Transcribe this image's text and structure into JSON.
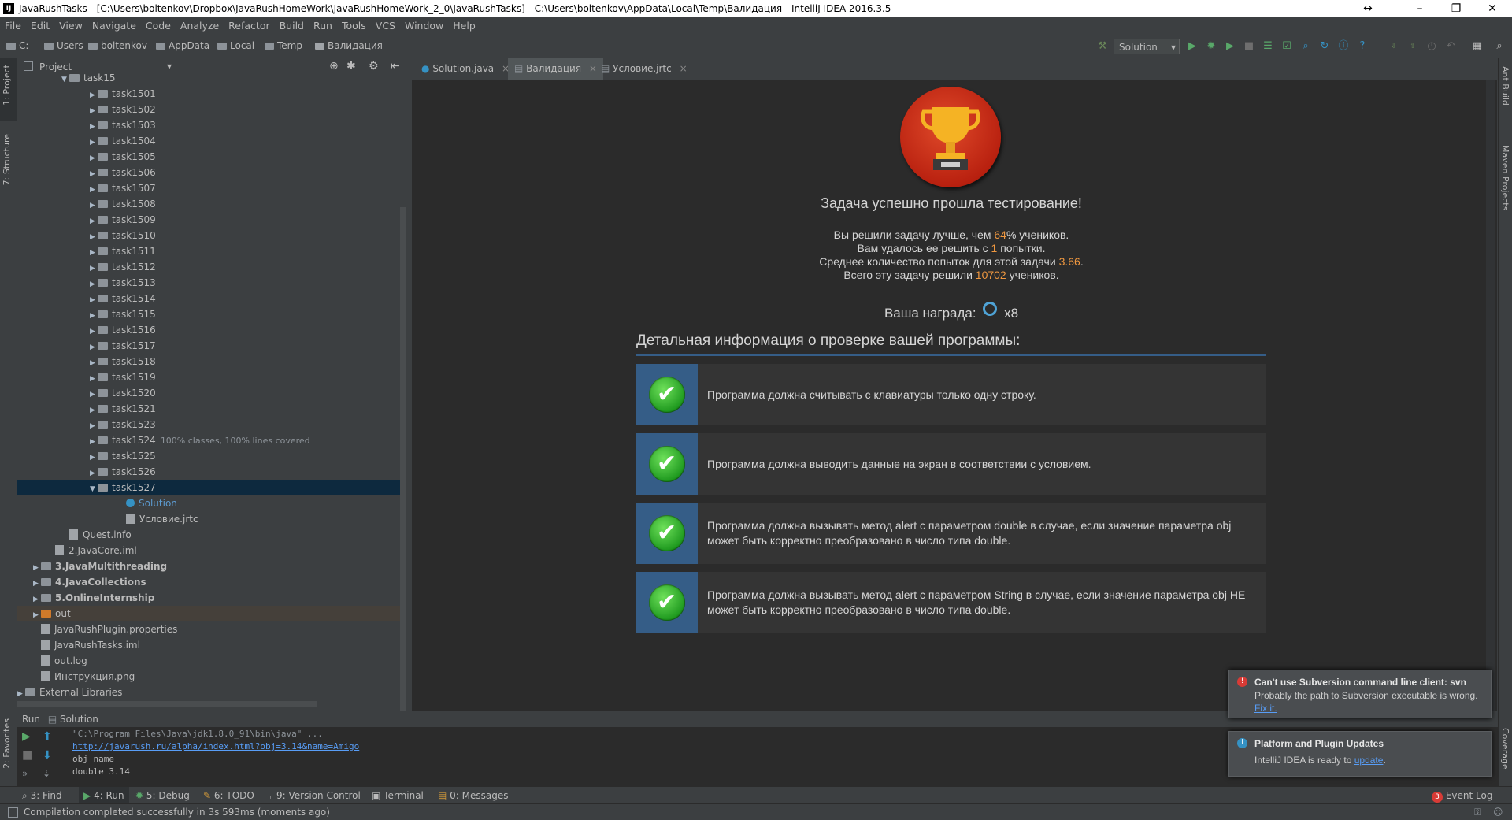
{
  "window": {
    "title": "JavaRushTasks - [C:\\Users\\boltenkov\\Dropbox\\JavaRushHomeWork\\JavaRushHomeWork_2_0\\JavaRushTasks] - C:\\Users\\boltenkov\\AppData\\Local\\Temp\\Валидация - IntelliJ IDEA 2016.3.5",
    "app_icon_text": "IJ"
  },
  "menu": [
    "File",
    "Edit",
    "View",
    "Navigate",
    "Code",
    "Analyze",
    "Refactor",
    "Build",
    "Run",
    "Tools",
    "VCS",
    "Window",
    "Help"
  ],
  "breadcrumb": [
    "C:",
    "Users",
    "boltenkov",
    "AppData",
    "Local",
    "Temp",
    "Валидация"
  ],
  "run_config": "Solution",
  "left_strip": {
    "project": "1: Project",
    "structure": "7: Structure",
    "favorites": "2: Favorites"
  },
  "right_strip": {
    "ant": "Ant Build",
    "maven": "Maven Projects",
    "coverage": "Coverage"
  },
  "project_panel": {
    "title": "Project",
    "tree": [
      {
        "label": "task15",
        "indent": 1,
        "type": "pkg",
        "arrow": "▼"
      },
      {
        "label": "task1501",
        "indent": 2,
        "type": "pkg",
        "arrow": "▶"
      },
      {
        "label": "task1502",
        "indent": 2,
        "type": "pkg",
        "arrow": "▶"
      },
      {
        "label": "task1503",
        "indent": 2,
        "type": "pkg",
        "arrow": "▶"
      },
      {
        "label": "task1504",
        "indent": 2,
        "type": "pkg",
        "arrow": "▶"
      },
      {
        "label": "task1505",
        "indent": 2,
        "type": "pkg",
        "arrow": "▶"
      },
      {
        "label": "task1506",
        "indent": 2,
        "type": "pkg",
        "arrow": "▶"
      },
      {
        "label": "task1507",
        "indent": 2,
        "type": "pkg",
        "arrow": "▶"
      },
      {
        "label": "task1508",
        "indent": 2,
        "type": "pkg",
        "arrow": "▶"
      },
      {
        "label": "task1509",
        "indent": 2,
        "type": "pkg",
        "arrow": "▶"
      },
      {
        "label": "task1510",
        "indent": 2,
        "type": "pkg",
        "arrow": "▶"
      },
      {
        "label": "task1511",
        "indent": 2,
        "type": "pkg",
        "arrow": "▶"
      },
      {
        "label": "task1512",
        "indent": 2,
        "type": "pkg",
        "arrow": "▶"
      },
      {
        "label": "task1513",
        "indent": 2,
        "type": "pkg",
        "arrow": "▶"
      },
      {
        "label": "task1514",
        "indent": 2,
        "type": "pkg",
        "arrow": "▶"
      },
      {
        "label": "task1515",
        "indent": 2,
        "type": "pkg",
        "arrow": "▶"
      },
      {
        "label": "task1516",
        "indent": 2,
        "type": "pkg",
        "arrow": "▶"
      },
      {
        "label": "task1517",
        "indent": 2,
        "type": "pkg",
        "arrow": "▶"
      },
      {
        "label": "task1518",
        "indent": 2,
        "type": "pkg",
        "arrow": "▶"
      },
      {
        "label": "task1519",
        "indent": 2,
        "type": "pkg",
        "arrow": "▶"
      },
      {
        "label": "task1520",
        "indent": 2,
        "type": "pkg",
        "arrow": "▶"
      },
      {
        "label": "task1521",
        "indent": 2,
        "type": "pkg",
        "arrow": "▶"
      },
      {
        "label": "task1523",
        "indent": 2,
        "type": "pkg",
        "arrow": "▶"
      },
      {
        "label": "task1524",
        "indent": 2,
        "type": "pkg",
        "arrow": "▶",
        "note": "100% classes, 100% lines covered"
      },
      {
        "label": "task1525",
        "indent": 2,
        "type": "pkg",
        "arrow": "▶"
      },
      {
        "label": "task1526",
        "indent": 2,
        "type": "pkg",
        "arrow": "▶"
      },
      {
        "label": "task1527",
        "indent": 2,
        "type": "pkg",
        "arrow": "▼",
        "selected": true
      },
      {
        "label": "Solution",
        "indent": 3,
        "type": "class",
        "arrow": ""
      },
      {
        "label": "Условие.jrtc",
        "indent": 3,
        "type": "file",
        "arrow": ""
      },
      {
        "label": "Quest.info",
        "indent": 1,
        "type": "file",
        "arrow": ""
      },
      {
        "label": "2.JavaCore.iml",
        "indent": 0.5,
        "type": "file",
        "arrow": ""
      },
      {
        "label": "3.JavaMultithreading",
        "indent": 0,
        "type": "module",
        "arrow": "▶",
        "bold": true
      },
      {
        "label": "4.JavaCollections",
        "indent": 0,
        "type": "module",
        "arrow": "▶",
        "bold": true
      },
      {
        "label": "5.OnlineInternship",
        "indent": 0,
        "type": "module",
        "arrow": "▶",
        "bold": true
      },
      {
        "label": "out",
        "indent": 0,
        "type": "out",
        "arrow": "▶",
        "highlight": true
      },
      {
        "label": "JavaRushPlugin.properties",
        "indent": 0,
        "type": "file",
        "arrow": ""
      },
      {
        "label": "JavaRushTasks.iml",
        "indent": 0,
        "type": "file",
        "arrow": ""
      },
      {
        "label": "out.log",
        "indent": 0,
        "type": "file",
        "arrow": ""
      },
      {
        "label": "Инструкция.png",
        "indent": 0,
        "type": "file",
        "arrow": ""
      },
      {
        "label": "External Libraries",
        "indent": -1,
        "type": "lib",
        "arrow": "▶"
      }
    ]
  },
  "editor_tabs": [
    {
      "label": "Solution.java",
      "active": false
    },
    {
      "label": "Валидация",
      "active": true
    },
    {
      "label": "Условие.jrtc",
      "active": false
    }
  ],
  "result": {
    "heading": "Задача успешно прошла тестирование!",
    "stats": {
      "l1_pre": "Вы решили задачу лучше, чем ",
      "l1_val": "64",
      "l1_post": "% учеников.",
      "l2_pre": "Вам удалось ее решить с ",
      "l2_val": "1",
      "l2_post": " попытки.",
      "l3_pre": "Среднее количество попыток для этой задачи ",
      "l3_val": "3.66",
      "l3_post": ".",
      "l4_pre": "Всего эту задачу решили ",
      "l4_val": "10702",
      "l4_post": " учеников."
    },
    "reward_label": "Ваша награда:",
    "reward_count": "x8",
    "details_heading": "Детальная информация о проверке вашей программы:",
    "checks": [
      {
        "text": "Программа должна считывать с клавиатуры только одну строку."
      },
      {
        "text": "Программа должна выводить данные на экран в соответствии с условием."
      },
      {
        "text": "Программа должна вызывать метод alert с параметром double в случае, если значение параметра obj может быть корректно преобразовано в число типа double."
      },
      {
        "text": "Программа должна вызывать метод alert с параметром String в случае, если значение параметра obj НЕ может быть корректно преобразовано в число типа double."
      }
    ]
  },
  "run_panel": {
    "title_prefix": "Run",
    "config": "Solution",
    "lines": [
      "\"C:\\Program Files\\Java\\jdk1.8.0_91\\bin\\java\" ...",
      "http://javarush.ru/alpha/index.html?obj=3.14&name=Amigo",
      "obj name",
      "double 3.14"
    ]
  },
  "bottom_tabs": {
    "find": "3: Find",
    "run": "4: Run",
    "debug": "5: Debug",
    "todo": "6: TODO",
    "vcs": "9: Version Control",
    "terminal": "Terminal",
    "messages": "0: Messages",
    "event_log": "Event Log",
    "event_count": "3"
  },
  "status": "Compilation completed successfully in 3s 593ms (moments ago)",
  "notifications": {
    "svn_title": "Can't use Subversion command line client: svn",
    "svn_body": "Probably the path to Subversion executable is wrong.",
    "svn_link": "Fix it.",
    "upd_title": "Platform and Plugin Updates",
    "upd_body": "IntelliJ IDEA is ready to ",
    "upd_link": "update",
    "upd_tail": "."
  },
  "colors": {
    "accent_orange": "#f09840",
    "check_side": "#355d87",
    "selection": "#0d293e"
  }
}
